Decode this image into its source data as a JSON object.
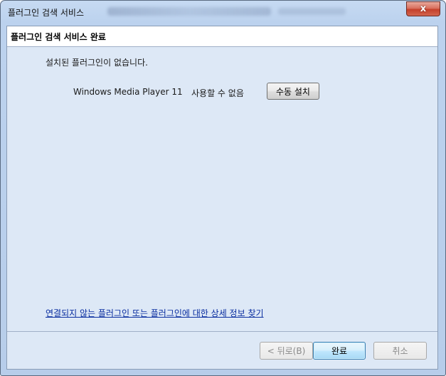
{
  "window": {
    "title": "플러그인 검색 서비스",
    "close_label": "x"
  },
  "header": {
    "title": "플러그인 검색 서비스 완료"
  },
  "main": {
    "message": "설치된 플러그인이 없습니다.",
    "plugin": {
      "name": "Windows Media Player 11",
      "status": "사용할 수 없음",
      "action_label": "수동 설치"
    },
    "link_text": "연결되지 않는 플러그인 또는 플러그인에 대한 상세 정보 찾기"
  },
  "footer": {
    "back_label": "< 뒤로(B)",
    "finish_label": "완료",
    "cancel_label": "취소"
  }
}
